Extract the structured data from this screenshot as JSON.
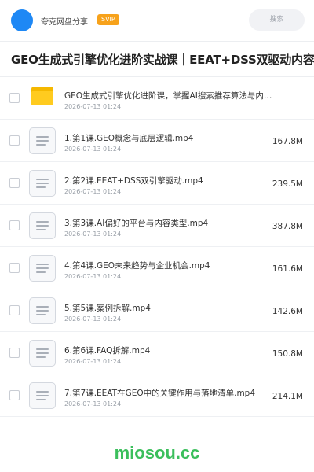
{
  "header": {
    "username": "夸克网盘分享",
    "badge": "SVIP",
    "search_label": "搜索"
  },
  "title": "GEO生成式引擎优化进阶实战课｜EEAT+DSS双驱动内容体系",
  "items": [
    {
      "type": "folder",
      "icon": "folder-icon",
      "name": "GEO生成式引擎优化进阶课，掌握AI搜索推荐算法与内容策略",
      "date": "2026-07-13 01:24",
      "size": ""
    },
    {
      "type": "file",
      "icon": "document-icon",
      "name": "1.第1课.GEO概念与底层逻辑.mp4",
      "date": "2026-07-13 01:24",
      "size": "167.8M"
    },
    {
      "type": "file",
      "icon": "document-icon",
      "name": "2.第2课.EEAT+DSS双引擎驱动.mp4",
      "date": "2026-07-13 01:24",
      "size": "239.5M"
    },
    {
      "type": "file",
      "icon": "document-icon",
      "name": "3.第3课.AI偏好的平台与内容类型.mp4",
      "date": "2026-07-13 01:24",
      "size": "387.8M"
    },
    {
      "type": "file",
      "icon": "document-icon",
      "name": "4.第4课.GEO未来趋势与企业机会.mp4",
      "date": "2026-07-13 01:24",
      "size": "161.6M"
    },
    {
      "type": "file",
      "icon": "document-icon",
      "name": "5.第5课.案例拆解.mp4",
      "date": "2026-07-13 01:24",
      "size": "142.6M"
    },
    {
      "type": "file",
      "icon": "document-icon",
      "name": "6.第6课.FAQ拆解.mp4",
      "date": "2026-07-13 01:24",
      "size": "150.8M"
    },
    {
      "type": "file",
      "icon": "document-icon",
      "name": "7.第7课.EEAT在GEO中的关键作用与落地清单.mp4",
      "date": "2026-07-13 01:24",
      "size": "214.1M"
    }
  ],
  "watermark": "miosou.cc",
  "colors": {
    "avatar": "#1e88f5",
    "badge": "#f7a21b",
    "folder": "#ffcb1f",
    "watermark": "#3bbf5c"
  }
}
